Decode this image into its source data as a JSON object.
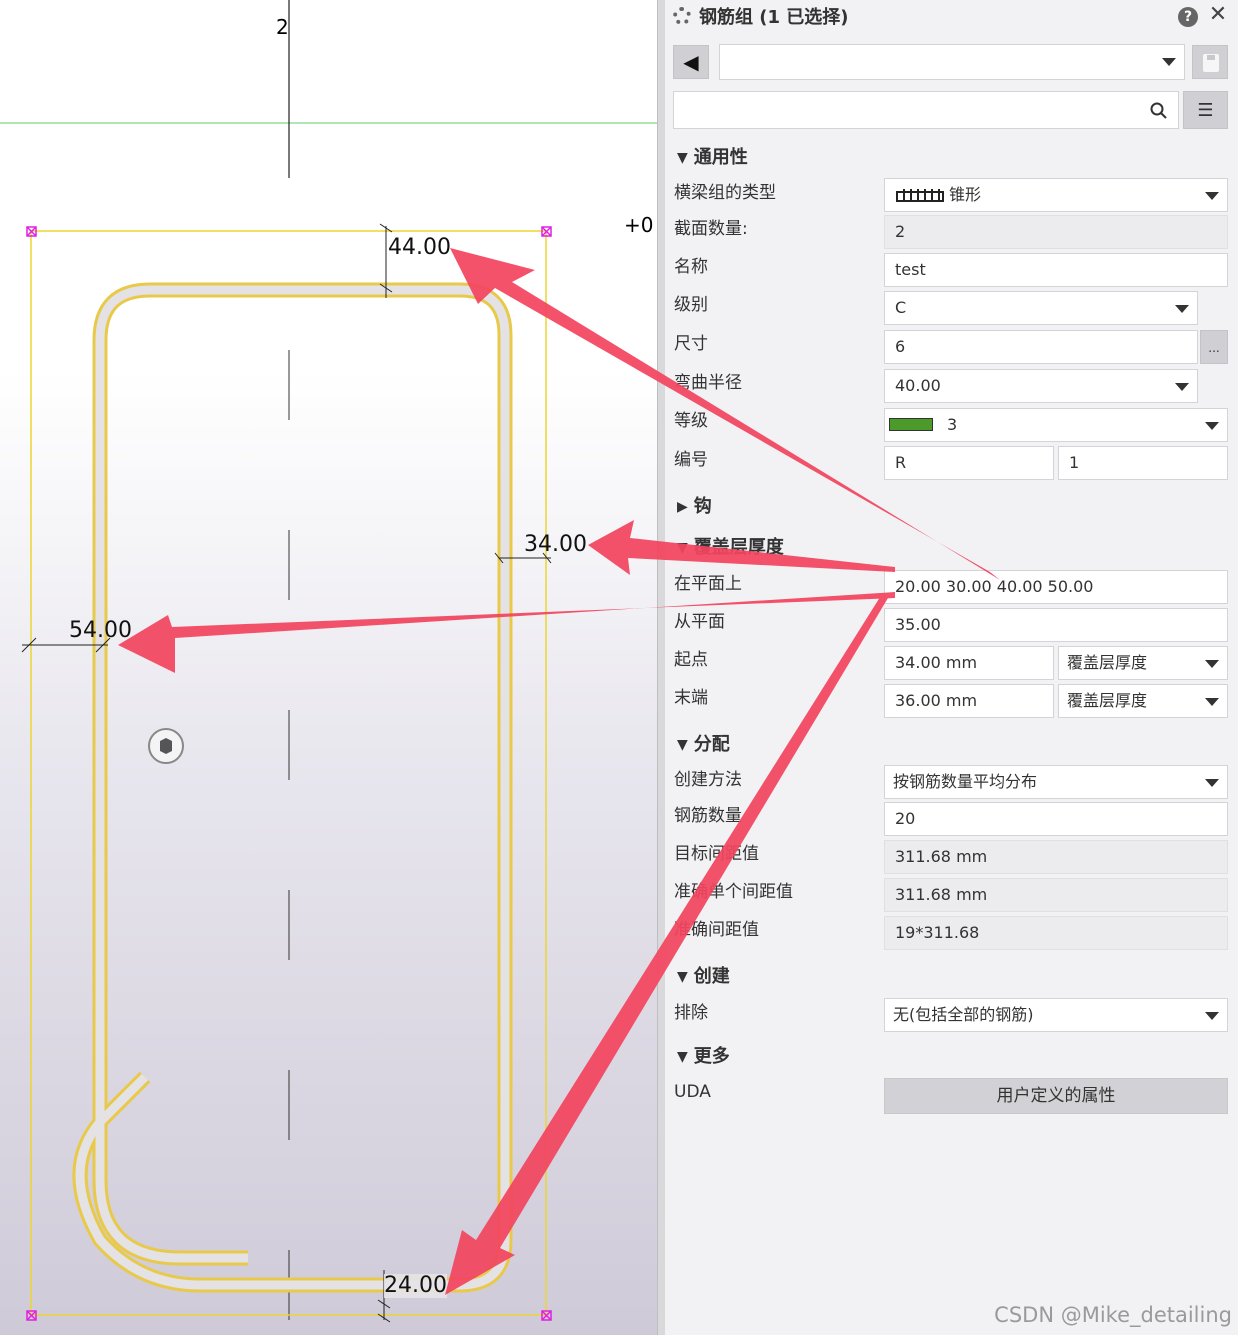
{
  "viewport": {
    "axis_label_top": "2",
    "axis_label_right": "+0",
    "dimensions": {
      "top": "44.00",
      "right": "34.00",
      "left": "54.00",
      "bottom": "24.00"
    }
  },
  "panel": {
    "title": "钢筋组 (1 已选择)",
    "icons": {
      "settings": "gear-icon",
      "help": "?",
      "close": "✕",
      "back": "◀",
      "save": "save-icon",
      "search": "search-icon",
      "menu": "☰",
      "more": "..."
    },
    "sections": {
      "general": {
        "header": "通用性",
        "rows": {
          "group_type": {
            "label": "横梁组的类型",
            "value": "锥形"
          },
          "section_count": {
            "label": "截面数量:",
            "value": "2"
          },
          "name": {
            "label": "名称",
            "value": "test"
          },
          "grade": {
            "label": "级别",
            "value": "C"
          },
          "size": {
            "label": "尺寸",
            "value": "6"
          },
          "bend_radius": {
            "label": "弯曲半径",
            "value": "40.00"
          },
          "class": {
            "label": "等级",
            "value": "3",
            "color": "#4c9a2a"
          },
          "numbering": {
            "label": "编号",
            "prefix": "R",
            "start": "1"
          }
        }
      },
      "hooks": {
        "header": "钩"
      },
      "cover": {
        "header": "覆盖层厚度",
        "rows": {
          "in_plane": {
            "label": "在平面上",
            "value": "20.00 30.00 40.00 50.00"
          },
          "from_plane": {
            "label": "从平面",
            "value": "35.00"
          },
          "start": {
            "label": "起点",
            "value": "34.00 mm",
            "option": "覆盖层厚度"
          },
          "end": {
            "label": "末端",
            "value": "36.00 mm",
            "option": "覆盖层厚度"
          }
        }
      },
      "distribution": {
        "header": "分配",
        "rows": {
          "method": {
            "label": "创建方法",
            "value": "按钢筋数量平均分布"
          },
          "count": {
            "label": "钢筋数量",
            "value": "20"
          },
          "target_spacing": {
            "label": "目标间距值",
            "value": "311.68 mm"
          },
          "exact_single": {
            "label": "准确单个间距值",
            "value": "311.68 mm"
          },
          "exact_spacing": {
            "label": "准确间距值",
            "value": "19*311.68"
          }
        }
      },
      "creation": {
        "header": "创建",
        "rows": {
          "exclude": {
            "label": "排除",
            "value": "无(包括全部的钢筋)"
          }
        }
      },
      "more": {
        "header": "更多",
        "rows": {
          "uda": {
            "label": "UDA",
            "button": "用户定义的属性"
          }
        }
      }
    }
  },
  "watermark": "CSDN @Mike_detailing",
  "colors": {
    "arrow": "#f2455f",
    "rebar": "#e8c94a",
    "bbox": "#ecd532",
    "handle": "#e020e0"
  }
}
